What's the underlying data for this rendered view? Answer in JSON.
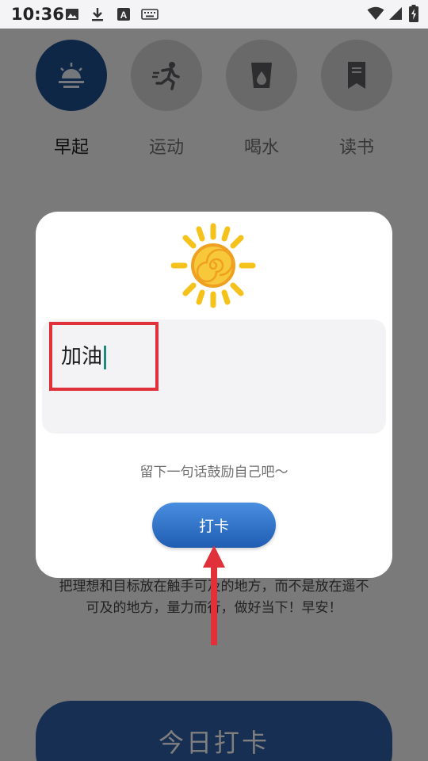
{
  "status_bar": {
    "time": "10:36",
    "icons": [
      "image-icon",
      "download-icon",
      "text-a-icon",
      "keyboard-icon",
      "wifi-icon",
      "signal-icon",
      "battery-charging-icon"
    ],
    "a_glyph": "A"
  },
  "categories": [
    {
      "label": "早起",
      "icon": "sunrise-icon",
      "active": true
    },
    {
      "label": "运动",
      "icon": "running-icon",
      "active": false
    },
    {
      "label": "喝水",
      "icon": "water-cup-icon",
      "active": false
    },
    {
      "label": "读书",
      "icon": "bookmark-icon",
      "active": false
    }
  ],
  "background": {
    "quote_line1": "把理想和目标放在触手可及的地方，而不是放在遥不",
    "quote_line2": "可及的地方，量力而行，做好当下！早安！",
    "checkin_button": "今日打卡"
  },
  "dialog": {
    "input_value": "加油",
    "hint": "留下一句话鼓励自己吧～",
    "submit_label": "打卡"
  },
  "colors": {
    "active_circle": "#1d4f8f",
    "inactive_circle": "#d2d2d5",
    "button_blue": "#2f6fc8",
    "highlight_red": "#e0303a",
    "caret": "#1f8a7a",
    "sun_yellow": "#f5c21b",
    "sun_orange": "#f0a020"
  }
}
